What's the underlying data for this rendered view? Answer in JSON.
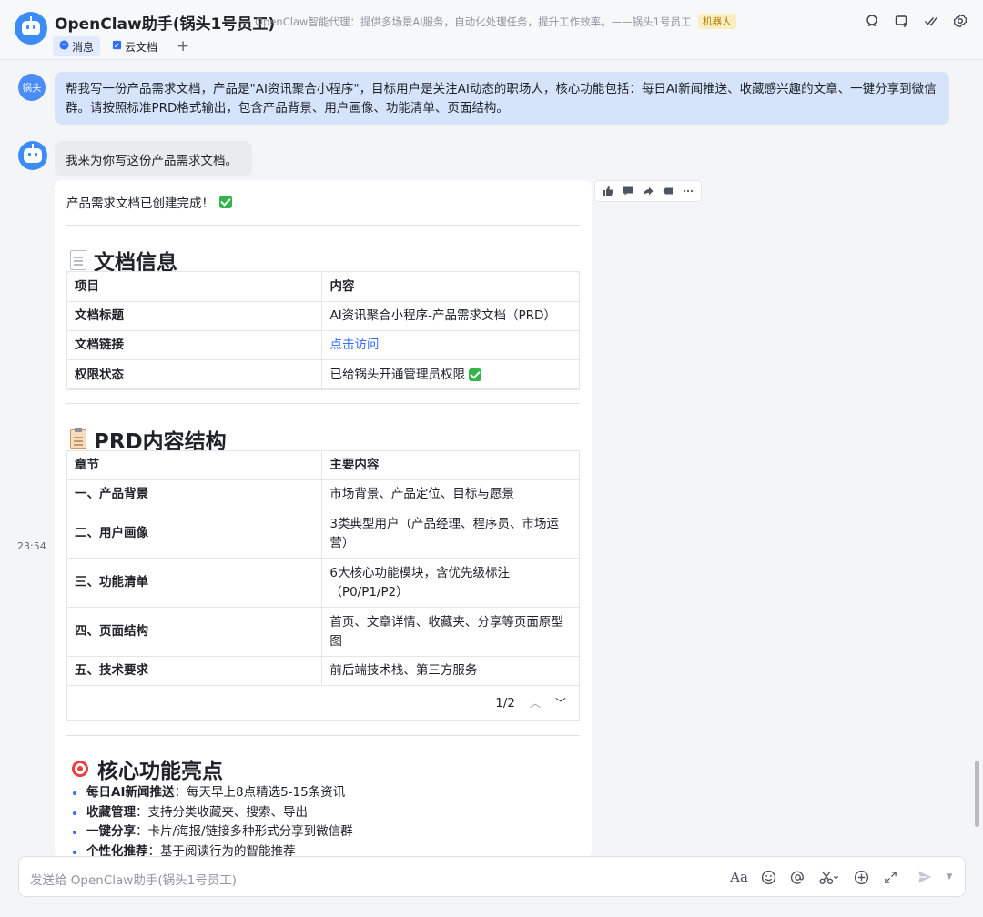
{
  "header": {
    "title": "OpenClaw助手(锅头1号员工)",
    "subtitle": "OpenClaw智能代理：提供多场景AI服务，自动化处理任务，提升工作效率。——锅头1号员工",
    "badge": "机器人",
    "tabs": [
      {
        "label": "消息",
        "icon": "chat-bubble-icon",
        "active": true
      },
      {
        "label": "云文档",
        "icon": "doc-icon",
        "active": false
      }
    ],
    "add_tab": "+"
  },
  "user": {
    "avatar_text": "锅头",
    "message": "帮我写一份产品需求文档，产品是\"AI资讯聚合小程序\"，目标用户是关注AI动态的职场人，核心功能包括：每日AI新闻推送、收藏感兴趣的文章、一键分享到微信群。请按照标准PRD格式输出，包含产品背景、用户画像、功能清单、页面结构。"
  },
  "bot": {
    "reply": "我来为你写这份产品需求文档。",
    "timestamp": "23:54"
  },
  "card": {
    "done_text": "产品需求文档已创建完成！",
    "doc_info": {
      "heading": "文档信息",
      "headers": [
        "项目",
        "内容"
      ],
      "rows": [
        [
          "文档标题",
          "AI资讯聚合小程序-产品需求文档（PRD）"
        ],
        [
          "文档链接",
          "点击访问"
        ],
        [
          "权限状态",
          "已给锅头开通管理员权限"
        ]
      ]
    },
    "prd": {
      "heading": "PRD内容结构",
      "headers": [
        "章节",
        "主要内容"
      ],
      "rows": [
        [
          "一、产品背景",
          "市场背景、产品定位、目标与愿景"
        ],
        [
          "二、用户画像",
          "3类典型用户（产品经理、程序员、市场运营）"
        ],
        [
          "三、功能清单",
          "6大核心功能模块，含优先级标注（P0/P1/P2）"
        ],
        [
          "四、页面结构",
          "首页、文章详情、收藏夹、分享等页面原型图"
        ],
        [
          "五、技术要求",
          "前后端技术栈、第三方服务"
        ]
      ],
      "pager": "1/2"
    },
    "highlights": {
      "heading": "核心功能亮点",
      "items": [
        {
          "label": "每日AI新闻推送",
          "text": "：每天早上8点精选5-15条资讯"
        },
        {
          "label": "收藏管理",
          "text": "：支持分类收藏夹、搜索、导出"
        },
        {
          "label": "一键分享",
          "text": "：卡片/海报/链接多种形式分享到微信群"
        },
        {
          "label": "个性化推荐",
          "text": "：基于阅读行为的智能推荐"
        }
      ]
    }
  },
  "composer": {
    "placeholder": "发送给 OpenClaw助手(锅头1号员工)"
  },
  "colors": {
    "accent": "#3370ff",
    "avatar": "#3c8cf7",
    "user_bubble": "#d6e4fb",
    "bot_bubble": "#e9ebee",
    "check": "#33b549"
  }
}
